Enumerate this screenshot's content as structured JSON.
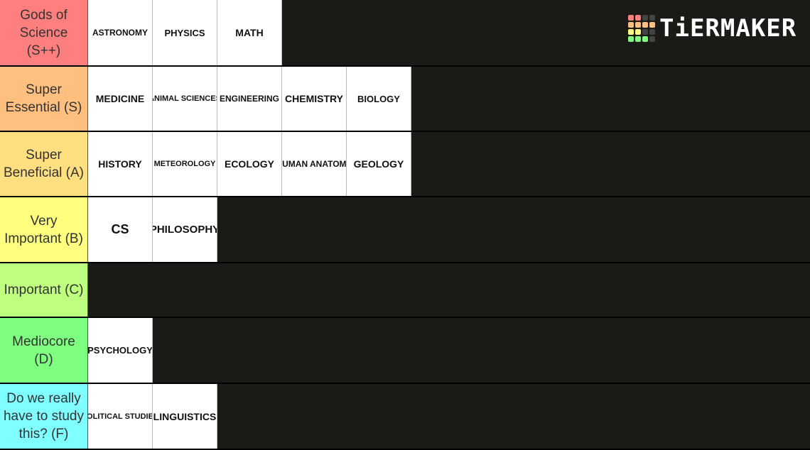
{
  "brand": {
    "name": "TiERMAKER",
    "grid_colors": [
      "#ff7f7f",
      "#ff7f7f",
      "#444444",
      "#444444",
      "#ffbf7f",
      "#ffbf7f",
      "#ffbf7f",
      "#ffbf7f",
      "#ffff7f",
      "#ffff7f",
      "#444444",
      "#444444",
      "#7fff7f",
      "#7fff7f",
      "#7fff7f",
      "#444444"
    ]
  },
  "tiers": [
    {
      "label": "Gods of Science (S++)",
      "color": "#ff7f7f",
      "items": [
        {
          "text": "ASTRONOMY"
        },
        {
          "text": "PHYSICS"
        },
        {
          "text": "MATH"
        }
      ]
    },
    {
      "label": "Super Essential (S)",
      "color": "#ffbf7f",
      "items": [
        {
          "text": "MEDICINE"
        },
        {
          "text": "ANIMAL SCIENCES"
        },
        {
          "text": "ENGINEERING"
        },
        {
          "text": "CHEMISTRY"
        },
        {
          "text": "BIOLOGY"
        }
      ]
    },
    {
      "label": "Super Beneficial (A)",
      "color": "#ffdf7f",
      "items": [
        {
          "text": "HISTORY"
        },
        {
          "text": "METEOROLOGY"
        },
        {
          "text": "ECOLOGY"
        },
        {
          "text": "HUMAN ANATOMY"
        },
        {
          "text": "GEOLOGY"
        }
      ]
    },
    {
      "label": "Very Important (B)",
      "color": "#ffff7f",
      "items": [
        {
          "text": "CS"
        },
        {
          "text": "PHILOSOPHY"
        }
      ]
    },
    {
      "label": "Important (C)",
      "color": "#bfff7f",
      "items": []
    },
    {
      "label": "Mediocore (D)",
      "color": "#7fff7f",
      "items": [
        {
          "text": "PSYCHOLOGY"
        }
      ]
    },
    {
      "label": "Do we really have to study this? (F)",
      "color": "#7fffff",
      "items": [
        {
          "text": "POLITICAL STUDIES"
        },
        {
          "text": "LINGUISTICS"
        }
      ]
    }
  ]
}
